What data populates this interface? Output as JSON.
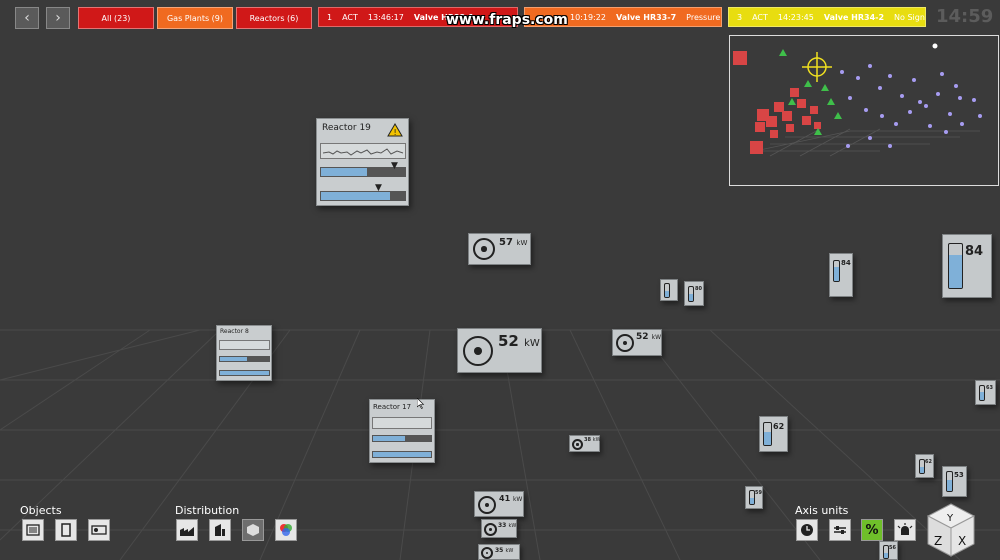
{
  "header": {
    "filters": [
      {
        "label": "All (23)",
        "color": "#d01818"
      },
      {
        "label": "Gas Plants (9)",
        "color": "#f06a20"
      },
      {
        "label": "Reactors (6)",
        "color": "#d01818"
      }
    ],
    "alerts": [
      {
        "index": "1",
        "state": "ACT",
        "time": "13:46:17",
        "valve": "Valve HR33-1",
        "kind": "",
        "color": "#d01818"
      },
      {
        "index": "",
        "state": "ACT",
        "time": "10:19:22",
        "valve": "Valve HR33-7",
        "kind": "Pressure",
        "color": "#f06a20"
      },
      {
        "index": "3",
        "state": "ACT",
        "time": "14:23:45",
        "valve": "Valve HR34-2",
        "kind": "No Signal",
        "color": "#e8dd10"
      }
    ],
    "clock": "14:59",
    "watermark": "www.fraps.com"
  },
  "reactors": [
    {
      "title": "Reactor 19",
      "has_warning": true
    },
    {
      "title": "Reactor 8",
      "has_warning": false
    },
    {
      "title": "Reactor 17",
      "has_warning": false
    }
  ],
  "kw_widgets": [
    {
      "value": "57",
      "unit": "kW"
    },
    {
      "value": "52",
      "unit": "kW"
    },
    {
      "value": "52",
      "unit": "kW"
    },
    {
      "value": "38",
      "unit": "kW"
    },
    {
      "value": "41",
      "unit": "kW"
    },
    {
      "value": "33",
      "unit": "kW"
    },
    {
      "value": "35",
      "unit": "kW"
    }
  ],
  "tank_widgets": [
    {
      "value": "84",
      "fill": 0.75
    },
    {
      "value": "84",
      "fill": 0.7
    },
    {
      "value": "",
      "fill": 0.5
    },
    {
      "value": "80",
      "fill": 0.5
    },
    {
      "value": "62",
      "fill": 0.6
    },
    {
      "value": "63",
      "fill": 0.55
    },
    {
      "value": "62",
      "fill": 0.5
    },
    {
      "value": "53",
      "fill": 0.6
    },
    {
      "value": "59",
      "fill": 0.5
    },
    {
      "value": "56",
      "fill": 0.4
    }
  ],
  "bottom": {
    "objects_label": "Objects",
    "distribution_label": "Distribution",
    "axis_label": "Axis units",
    "objects_tools": [
      "list-icon",
      "single-panel-icon",
      "compact-icon"
    ],
    "distribution_tools": [
      "factory-icon",
      "building-icon",
      "hexagon-icon",
      "color-circles-icon"
    ],
    "axis_tools": [
      "clock-icon",
      "sliders-icon",
      "percent-icon",
      "alarm-icon"
    ],
    "percent_symbol": "%",
    "axis_cube_labels": [
      "Y",
      "Z",
      "X"
    ]
  },
  "colors": {
    "accent_green": "#6fbf2a",
    "alert_red": "#d01818",
    "alert_orange": "#f06a20",
    "alert_yellow": "#e8dd10",
    "gauge_fill": "#7fb0d8"
  }
}
